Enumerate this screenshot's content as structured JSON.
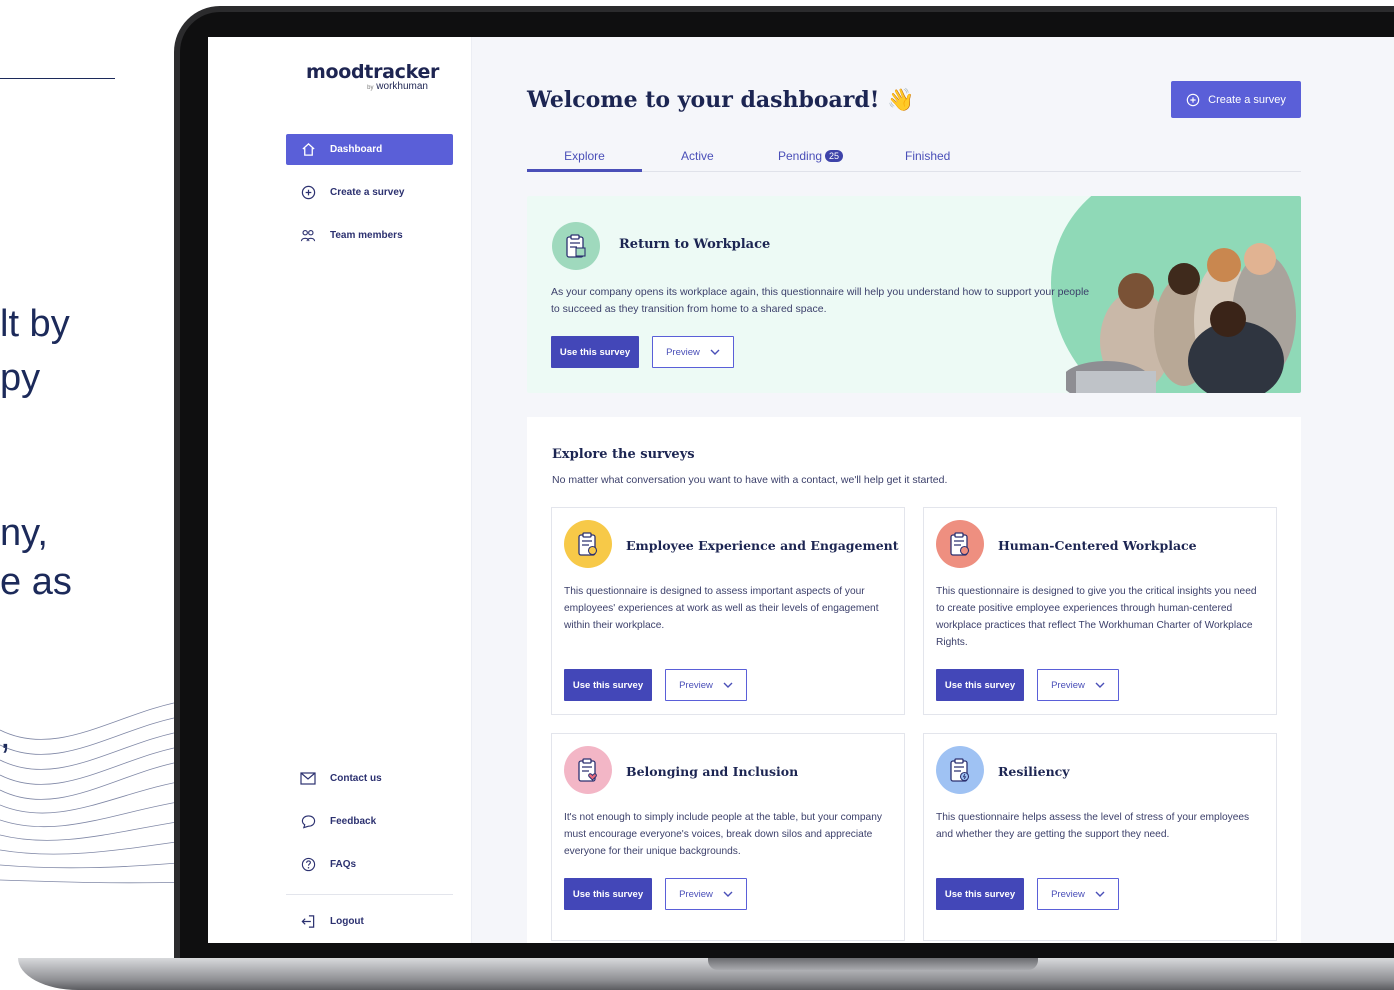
{
  "background": {
    "lines": [
      "lt by",
      "py",
      "ny,",
      "e as",
      ","
    ]
  },
  "app": {
    "logo": {
      "name": "moodtracker",
      "by": "by",
      "brand": "workhuman"
    },
    "accent_color": "#5a5fd8"
  },
  "sidebar": {
    "items": [
      {
        "label": "Dashboard",
        "icon": "home-icon"
      },
      {
        "label": "Create a survey",
        "icon": "plus-circle-icon"
      },
      {
        "label": "Team members",
        "icon": "team-icon"
      }
    ],
    "bottom_items": [
      {
        "label": "Contact us",
        "icon": "mail-icon"
      },
      {
        "label": "Feedback",
        "icon": "chat-bubble-icon"
      },
      {
        "label": "FAQs",
        "icon": "question-circle-icon"
      },
      {
        "label": "Logout",
        "icon": "logout-icon"
      }
    ]
  },
  "header": {
    "title": "Welcome to your dashboard! 👋",
    "create_label": "Create a survey"
  },
  "tabs": [
    {
      "label": "Explore",
      "active": true
    },
    {
      "label": "Active"
    },
    {
      "label": "Pending",
      "badge": "25"
    },
    {
      "label": "Finished"
    }
  ],
  "featured": {
    "title": "Return to Workplace",
    "description": "As your company opens its workplace again, this questionnaire will help you understand how to support your people to succeed as they transition from home to a shared space.",
    "use_label": "Use this survey",
    "preview_label": "Preview"
  },
  "explore": {
    "title": "Explore the surveys",
    "subtitle": "No matter what conversation you want to have with a contact, we'll help get it started.",
    "cards": [
      {
        "title": "Employee Experience and Engagement",
        "description": "This questionnaire is designed to assess important aspects of your employees' experiences at work as well as their levels of engagement within their workplace.",
        "use_label": "Use this survey",
        "preview_label": "Preview",
        "color": "#f7c948"
      },
      {
        "title": "Human-Centered Workplace",
        "description": "This questionnaire is designed to give you the critical insights you need to create positive employee experiences through human-centered workplace practices that reflect The Workhuman Charter of Workplace Rights.",
        "use_label": "Use this survey",
        "preview_label": "Preview",
        "color": "#ee8f80"
      },
      {
        "title": "Belonging and Inclusion",
        "description": "It's not enough to simply include people at the table, but your company must encourage everyone's voices, break down silos and appreciate everyone for their unique backgrounds.",
        "use_label": "Use this survey",
        "preview_label": "Preview",
        "color": "#f3b6c6"
      },
      {
        "title": "Resiliency",
        "description": "This questionnaire helps assess the level of stress of your employees and whether they are getting the support they need.",
        "use_label": "Use this survey",
        "preview_label": "Preview",
        "color": "#9fc2f3"
      }
    ]
  }
}
